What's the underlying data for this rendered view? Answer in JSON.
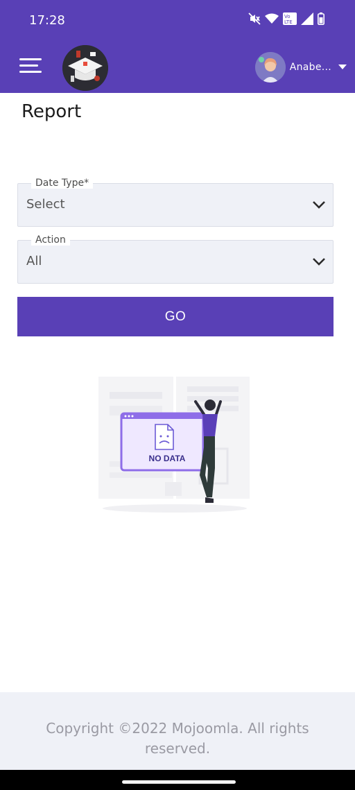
{
  "status_bar": {
    "time": "17:28"
  },
  "header": {
    "user_name": "Anabe..."
  },
  "page": {
    "title": "Report"
  },
  "form": {
    "date_type": {
      "label": "Date Type*",
      "value": "Select"
    },
    "action": {
      "label": "Action",
      "value": "All"
    },
    "go_label": "GO"
  },
  "empty_state": {
    "text": "NO DATA"
  },
  "footer": {
    "copyright": "Copyright ©2022 Mojoomla. All rights reserved."
  },
  "colors": {
    "primary": "#5940b6",
    "field_bg": "#eff1f7",
    "footer_text": "#9a9aa3"
  }
}
